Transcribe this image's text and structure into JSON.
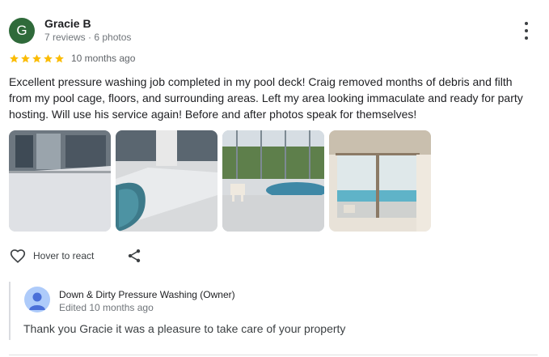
{
  "review": {
    "avatar_letter": "G",
    "avatar_color": "#2f6a3a",
    "reviewer_name": "Gracie B",
    "reviewer_meta": "7 reviews · 6 photos",
    "rating": 5,
    "rating_max": 5,
    "star_color": "#fbbc04",
    "time_ago": "10 months ago",
    "text": "Excellent pressure washing job completed in my pool deck! Craig removed months of debris and filth from my pool cage, floors, and surrounding areas. Left my area looking immaculate and ready for party hosting. Will use his service again! Before and after photos speak for themselves!",
    "photos": [
      {
        "icon": "pool-deck-photo"
      },
      {
        "icon": "pool-deck-clean-photo"
      },
      {
        "icon": "pool-with-dog-photo"
      },
      {
        "icon": "pool-through-door-photo"
      }
    ],
    "react_label": "Hover to react",
    "menu_icon": "more-vert-icon",
    "share_icon": "share-icon",
    "react_icon": "heart-outline-icon"
  },
  "owner_reply": {
    "name": "Down & Dirty Pressure Washing (Owner)",
    "edited": "Edited 10 months ago",
    "text": "Thank you Gracie it was a pleasure to take care of your property",
    "avatar_icon": "person-avatar-icon",
    "avatar_color": "#aecbfa"
  }
}
